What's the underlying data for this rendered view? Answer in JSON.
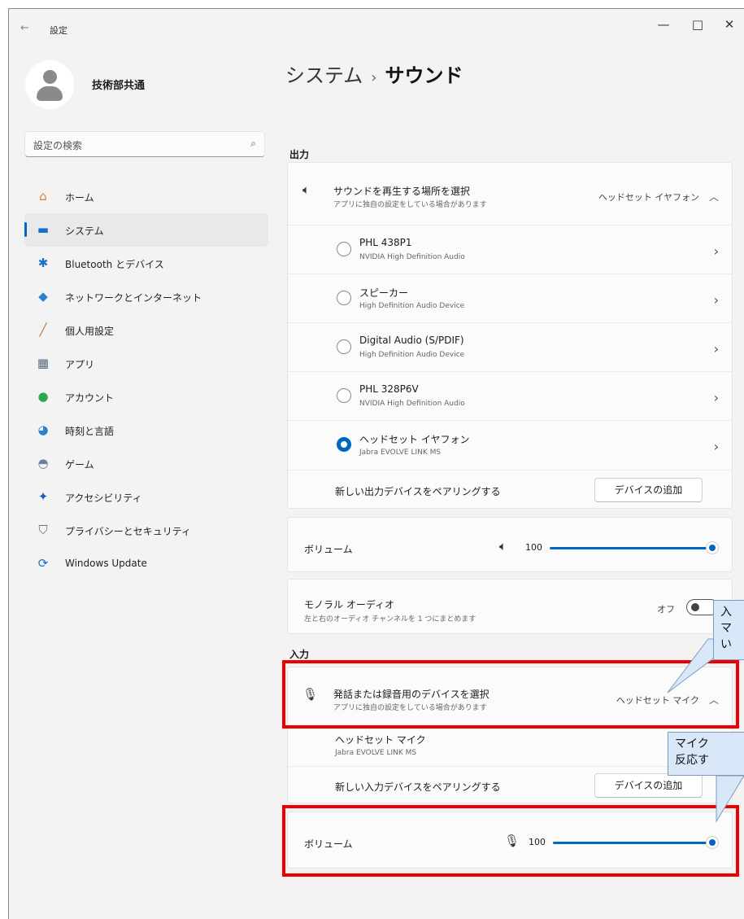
{
  "window": {
    "title": "設定",
    "back_icon": "←",
    "minimize": "—",
    "maximize": "□",
    "close": "✕"
  },
  "profile": {
    "name": "技術部共通"
  },
  "search": {
    "placeholder": "設定の検索",
    "icon": "⌕"
  },
  "sidebar": {
    "items": [
      {
        "label": "ホーム",
        "icon": "home-icon",
        "glyph": "⌂",
        "color": "#e07b2e"
      },
      {
        "label": "システム",
        "icon": "monitor-icon",
        "glyph": "▬",
        "color": "#1a70c8",
        "active": true
      },
      {
        "label": "Bluetooth とデバイス",
        "icon": "bluetooth-icon",
        "glyph": "✱",
        "color": "#1a70c8"
      },
      {
        "label": "ネットワークとインターネット",
        "icon": "wifi-icon",
        "glyph": "◆",
        "color": "#2a7fd0"
      },
      {
        "label": "個人用設定",
        "icon": "brush-icon",
        "glyph": "╱",
        "color": "#c07a30"
      },
      {
        "label": "アプリ",
        "icon": "apps-icon",
        "glyph": "▦",
        "color": "#5a6a80"
      },
      {
        "label": "アカウント",
        "icon": "account-icon",
        "glyph": "●",
        "color": "#2aa850"
      },
      {
        "label": "時刻と言語",
        "icon": "globe-clock-icon",
        "glyph": "◕",
        "color": "#2a7fd0"
      },
      {
        "label": "ゲーム",
        "icon": "gamepad-icon",
        "glyph": "◓",
        "color": "#6a80a0"
      },
      {
        "label": "アクセシビリティ",
        "icon": "accessibility-icon",
        "glyph": "✦",
        "color": "#1a60b8"
      },
      {
        "label": "プライバシーとセキュリティ",
        "icon": "shield-icon",
        "glyph": "⛉",
        "color": "#6a7080"
      },
      {
        "label": "Windows Update",
        "icon": "update-icon",
        "glyph": "⟳",
        "color": "#1a70c8"
      }
    ]
  },
  "breadcrumb": {
    "parent": "システム",
    "separator": "›",
    "current": "サウンド"
  },
  "output": {
    "section_label": "出力",
    "choose": {
      "title": "サウンドを再生する場所を選択",
      "subtitle": "アプリに独自の設定をしている場合があります",
      "value": "ヘッドセット イヤフォン"
    },
    "devices": [
      {
        "name": "PHL 438P1",
        "sub": "NVIDIA High Definition Audio",
        "selected": false
      },
      {
        "name": "スピーカー",
        "sub": "High Definition Audio Device",
        "selected": false
      },
      {
        "name": "Digital Audio (S/PDIF)",
        "sub": "High Definition Audio Device",
        "selected": false
      },
      {
        "name": "PHL 328P6V",
        "sub": "NVIDIA High Definition Audio",
        "selected": false
      },
      {
        "name": "ヘッドセット イヤフォン",
        "sub": "Jabra EVOLVE LINK MS",
        "selected": true
      }
    ],
    "pair_label": "新しい出力デバイスをペアリングする",
    "add_button": "デバイスの追加",
    "volume_label": "ボリューム",
    "volume_value": "100",
    "mono": {
      "title": "モノラル オーディオ",
      "subtitle": "左と右のオーディオ チャンネルを 1 つにまとめます",
      "state": "オフ"
    }
  },
  "input": {
    "section_label": "入力",
    "choose": {
      "title": "発話または録音用のデバイスを選択",
      "subtitle": "アプリに独自の設定をしている場合があります",
      "value": "ヘッドセット マイク"
    },
    "device": {
      "name": "ヘッドセット マイク",
      "sub": "Jabra EVOLVE LINK MS"
    },
    "pair_label": "新しい入力デバイスをペアリングする",
    "add_button": "デバイスの追加",
    "volume_label": "ボリューム",
    "volume_value": "100"
  },
  "callouts": {
    "first": [
      "入",
      "マ",
      "い"
    ],
    "second": [
      "マイク",
      "反応す"
    ]
  },
  "colors": {
    "accent": "#0067c0",
    "highlight": "#ee0000"
  }
}
